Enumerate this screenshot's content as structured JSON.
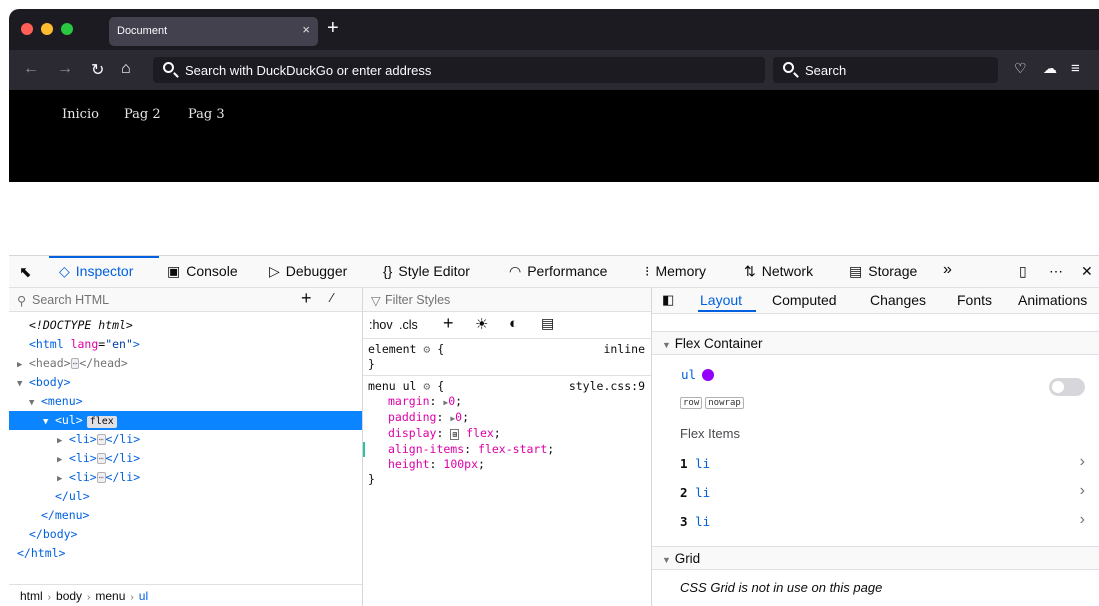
{
  "browser": {
    "tab_title": "Document",
    "tab_close": "×",
    "new_tab": "+",
    "url_placeholder": "Search with DuckDuckGo or enter address",
    "search_placeholder": "Search"
  },
  "page": {
    "menu_links": [
      "Inicio",
      "Pag 2",
      "Pag 3"
    ]
  },
  "devtools": {
    "tabs": [
      "Inspector",
      "Console",
      "Debugger",
      "Style Editor",
      "Performance",
      "Memory",
      "Network",
      "Storage"
    ],
    "active_tab": "Inspector",
    "overflow": "»"
  },
  "markup": {
    "search_placeholder": "Search HTML",
    "lines": [
      "<!DOCTYPE html>",
      "<html lang=\"en\">",
      "<head>…</head>",
      "<body>",
      "<menu>",
      "<ul> flex",
      "<li>…</li>",
      "<li>…</li>",
      "<li>…</li>",
      "</ul>",
      "</menu>",
      "</body>",
      "</html>"
    ],
    "breadcrumbs": [
      "html",
      "body",
      "menu",
      "ul"
    ]
  },
  "rules": {
    "filter_placeholder": "Filter Styles",
    "hov_label": ":hov",
    "cls_label": ".cls",
    "element_rule": {
      "selector": "element",
      "source": "inline"
    },
    "menu_rule": {
      "selector": "menu ul",
      "source": "style.css:9",
      "declarations": [
        {
          "prop": "margin",
          "value": "0"
        },
        {
          "prop": "padding",
          "value": "0"
        },
        {
          "prop": "display",
          "value": "flex"
        },
        {
          "prop": "align-items",
          "value": "flex-start"
        },
        {
          "prop": "height",
          "value": "100px"
        }
      ]
    }
  },
  "layout": {
    "tabs": [
      "Layout",
      "Computed",
      "Changes",
      "Fonts",
      "Animations"
    ],
    "active_tab": "Layout",
    "flex_container_header": "Flex Container",
    "container_name": "ul",
    "container_color": "#9400ff",
    "pills": [
      "row",
      "nowrap"
    ],
    "flex_items_header": "Flex Items",
    "items": [
      {
        "index": "1",
        "name": "li"
      },
      {
        "index": "2",
        "name": "li"
      },
      {
        "index": "3",
        "name": "li"
      }
    ],
    "grid_header": "Grid",
    "grid_message": "CSS Grid is not in use on this page"
  }
}
